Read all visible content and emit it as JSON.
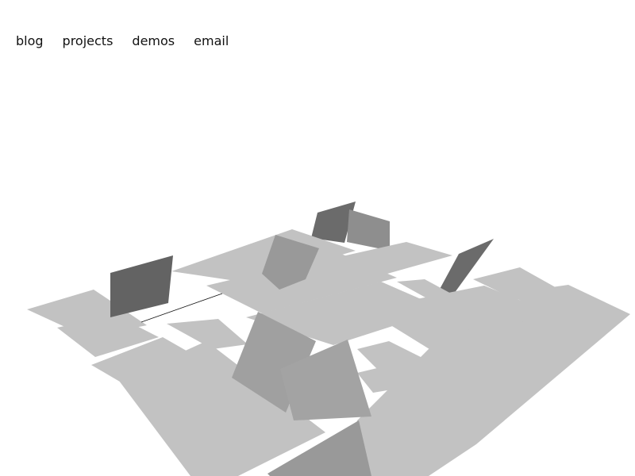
{
  "nav": {
    "items": [
      {
        "label": "blog"
      },
      {
        "label": "projects"
      },
      {
        "label": "demos"
      },
      {
        "label": "email"
      }
    ]
  },
  "scene": {
    "colors": {
      "background": "#ffffff",
      "floor": "#c2c2c2",
      "slab_light": "#a6a6a6",
      "slab_mid": "#999999",
      "slab_dark": "#6b6b6b",
      "slab_darkest": "#636363",
      "line": "#111111"
    }
  }
}
